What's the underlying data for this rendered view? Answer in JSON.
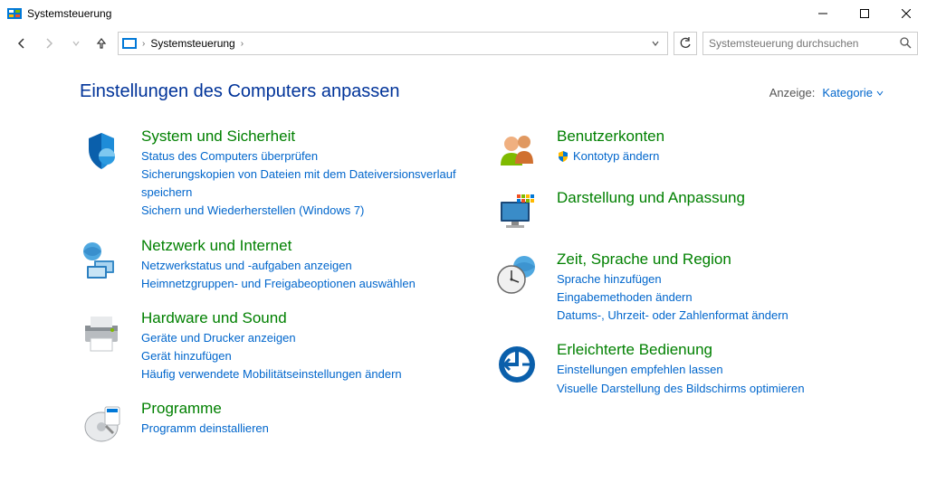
{
  "window": {
    "title": "Systemsteuerung"
  },
  "nav": {
    "breadcrumb": "Systemsteuerung",
    "search_placeholder": "Systemsteuerung durchsuchen"
  },
  "header": {
    "title": "Einstellungen des Computers anpassen",
    "view_label": "Anzeige:",
    "view_value": "Kategorie"
  },
  "left": [
    {
      "title": "System und Sicherheit",
      "links": [
        "Status des Computers überprüfen",
        "Sicherungskopien von Dateien mit dem Dateiversionsverlauf speichern",
        "Sichern und Wiederherstellen (Windows 7)"
      ]
    },
    {
      "title": "Netzwerk und Internet",
      "links": [
        "Netzwerkstatus und -aufgaben anzeigen",
        "Heimnetzgruppen- und Freigabeoptionen auswählen"
      ]
    },
    {
      "title": "Hardware und Sound",
      "links": [
        "Geräte und Drucker anzeigen",
        "Gerät hinzufügen",
        "Häufig verwendete Mobilitätseinstellungen ändern"
      ]
    },
    {
      "title": "Programme",
      "links": [
        "Programm deinstallieren"
      ]
    }
  ],
  "right": [
    {
      "title": "Benutzerkonten",
      "shield_link": "Kontotyp ändern",
      "links": []
    },
    {
      "title": "Darstellung und Anpassung",
      "links": []
    },
    {
      "title": "Zeit, Sprache und Region",
      "links": [
        "Sprache hinzufügen",
        "Eingabemethoden ändern",
        "Datums-, Uhrzeit- oder Zahlenformat ändern"
      ]
    },
    {
      "title": "Erleichterte Bedienung",
      "links": [
        "Einstellungen empfehlen lassen",
        "Visuelle Darstellung des Bildschirms optimieren"
      ]
    }
  ]
}
